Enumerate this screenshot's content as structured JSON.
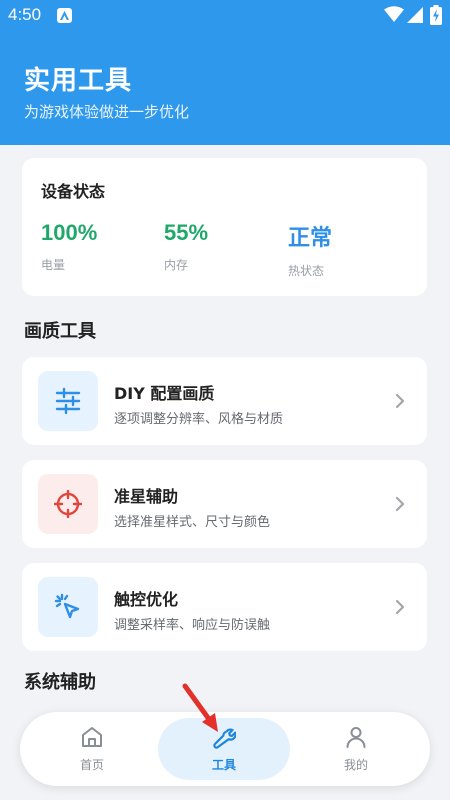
{
  "status_bar": {
    "time": "4:50"
  },
  "header": {
    "title": "实用工具",
    "subtitle": "为游戏体验做进一步优化"
  },
  "device_status": {
    "title": "设备状态",
    "stats": [
      {
        "value": "100%",
        "label": "电量",
        "color": "#1fa86a"
      },
      {
        "value": "55%",
        "label": "内存",
        "color": "#1fa86a"
      },
      {
        "value": "正常",
        "label": "热状态",
        "color": "#2e8fe6"
      }
    ]
  },
  "sections": {
    "graphics": "画质工具",
    "system": "系统辅助"
  },
  "tools": [
    {
      "title": "DIY 配置画质",
      "desc": "逐项调整分辨率、风格与材质",
      "icon": "sliders-icon",
      "icon_bg": "#e6f2fd",
      "icon_color": "#2e8fe6"
    },
    {
      "title": "准星辅助",
      "desc": "选择准星样式、尺寸与颜色",
      "icon": "crosshair-icon",
      "icon_bg": "#fdecec",
      "icon_color": "#e0463c"
    },
    {
      "title": "触控优化",
      "desc": "调整采样率、响应与防误触",
      "icon": "touch-pointer-icon",
      "icon_bg": "#e6f2fd",
      "icon_color": "#2e8fe6"
    }
  ],
  "nav": {
    "items": [
      {
        "label": "首页",
        "icon": "home-icon"
      },
      {
        "label": "工具",
        "icon": "wrench-icon",
        "active": true
      },
      {
        "label": "我的",
        "icon": "person-icon"
      }
    ]
  },
  "colors": {
    "accent": "#2e98ec",
    "annotation_arrow": "#e4302a"
  }
}
